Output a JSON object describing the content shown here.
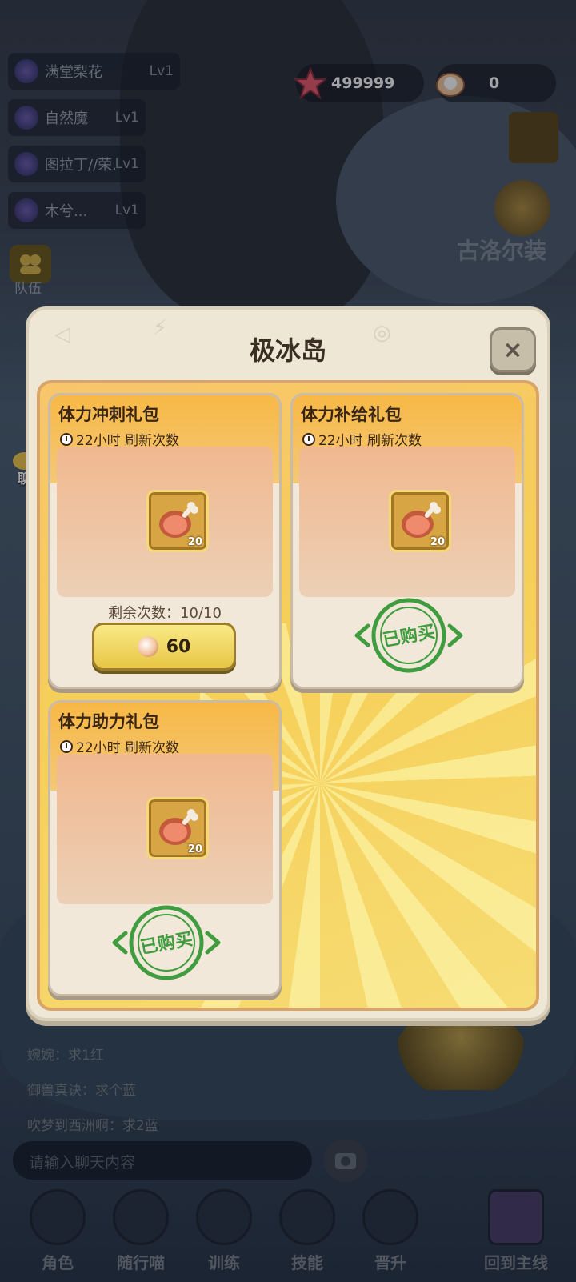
{
  "team": {
    "members": [
      {
        "name": "满堂梨花",
        "level": "Lv1"
      },
      {
        "name": "自然魔",
        "level": "Lv1"
      },
      {
        "name": "图拉丁//荣...",
        "level": "Lv1"
      },
      {
        "name": "木兮...",
        "level": "Lv1"
      }
    ],
    "label": "队伍"
  },
  "currencies": [
    {
      "icon": "starfish-icon",
      "value": "499999"
    },
    {
      "icon": "pearl-icon",
      "value": "0"
    }
  ],
  "background_text": {
    "right_banner": "古洛尔装"
  },
  "chat": {
    "bubble_label": "聊天",
    "messages": [
      "婉婉：求1红",
      "御兽真诀：求个蓝",
      "吹梦到西洲啊：求2蓝"
    ],
    "input_placeholder": "请输入聊天内容"
  },
  "modal": {
    "title": "极冰岛",
    "close_label": "×",
    "packs": [
      {
        "title": "体力冲刺礼包",
        "refresh": "22小时 刷新次数",
        "item_icon": "meat-icon",
        "item_count": "20",
        "remaining": "剩余次数：10/10",
        "price": "60",
        "purchased": false
      },
      {
        "title": "体力补给礼包",
        "refresh": "22小时 刷新次数",
        "item_icon": "meat-icon",
        "item_count": "20",
        "purchased": true,
        "stamp": "已购买"
      },
      {
        "title": "体力助力礼包",
        "refresh": "22小时 刷新次数",
        "item_icon": "meat-icon",
        "item_count": "20",
        "purchased": true,
        "stamp": "已购买"
      }
    ]
  },
  "nav": [
    {
      "label": "角色",
      "icon": "character-icon"
    },
    {
      "label": "随行喵",
      "icon": "lock-icon"
    },
    {
      "label": "训练",
      "icon": "lock-icon"
    },
    {
      "label": "技能",
      "icon": "lock-icon"
    },
    {
      "label": "晋升",
      "icon": "promote-icon"
    },
    {
      "label": "回到主线",
      "icon": "return-main-icon"
    }
  ]
}
